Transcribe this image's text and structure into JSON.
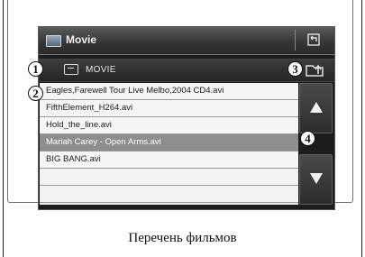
{
  "window": {
    "title": "Movie",
    "title_icon": "movie-app-icon",
    "back_icon": "return-icon"
  },
  "path": {
    "label": "MOVIE",
    "folder_icon": "folder-icon",
    "up_icon": "folder-up-icon"
  },
  "files": [
    {
      "name": "Eagles,Farewell Tour Live Melbo,2004 CD4.avi",
      "selected": false
    },
    {
      "name": "FifthElement_H264.avi",
      "selected": false
    },
    {
      "name": "Hold_the_line.avi",
      "selected": false
    },
    {
      "name": "Mariah Carey - Open Arms.avi",
      "selected": true
    },
    {
      "name": "BIG BANG.avi",
      "selected": false
    },
    {
      "name": "",
      "selected": false
    },
    {
      "name": "",
      "selected": false
    }
  ],
  "scroll": {
    "up_icon": "arrow-up-icon",
    "down_icon": "arrow-down-icon"
  },
  "callouts": [
    "1",
    "2",
    "3",
    "4"
  ],
  "caption": "Перечень фильмов",
  "colors": {
    "screen_bg": "#1c1c1c",
    "row_bg": "#f5f5f5",
    "row_selected_bg": "#8e8e8e",
    "row_selected_text": "#ffffff"
  }
}
